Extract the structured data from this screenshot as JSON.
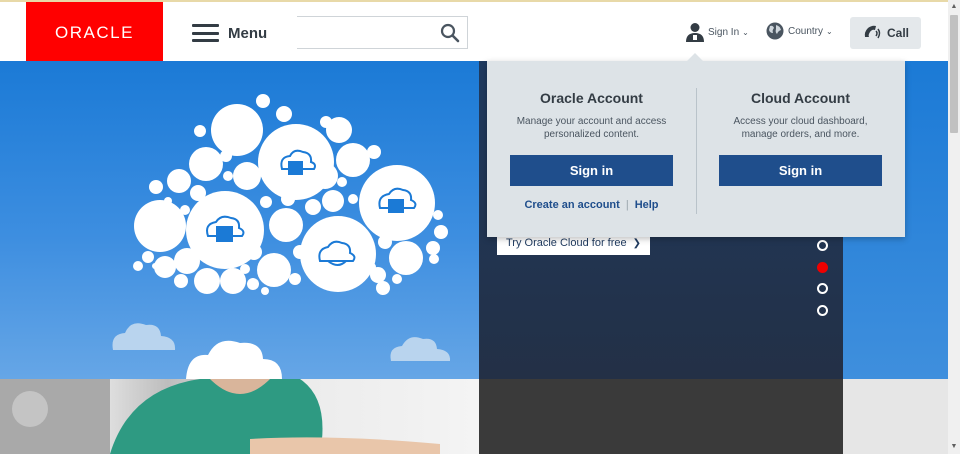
{
  "header": {
    "logo_text": "ORACLE",
    "menu_label": "Menu",
    "search": {
      "value": "",
      "placeholder": ""
    },
    "signin_label": "Sign In",
    "country_label": "Country",
    "call_label": "Call"
  },
  "hero": {
    "try_button_label": "Try Oracle Cloud for free",
    "try_button_arrow": "❯",
    "carousel": {
      "count": 4,
      "active_index": 1
    }
  },
  "account_panel": {
    "oracle": {
      "title": "Oracle Account",
      "description": "Manage your account and access personalized content.",
      "button_label": "Sign in",
      "create_link": "Create an account",
      "separator": "|",
      "help_link": "Help"
    },
    "cloud": {
      "title": "Cloud Account",
      "description": "Access your cloud dashboard, manage orders, and more.",
      "button_label": "Sign in"
    }
  },
  "colors": {
    "brand_red": "#ff0000",
    "button_blue": "#1f4e8c",
    "hero_blue": "#1b7ad6",
    "carousel_active": "#ee0000"
  },
  "icons": [
    "search-icon",
    "user-icon",
    "globe-icon",
    "phone-icon",
    "chevron-down-icon",
    "cloud-icon"
  ]
}
